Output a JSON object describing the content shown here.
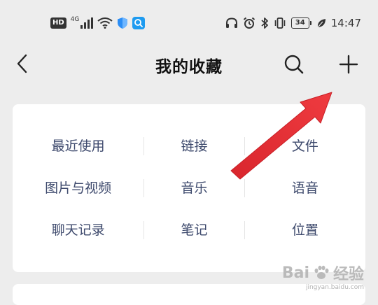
{
  "status_bar": {
    "hd_badge": "HD",
    "network": "4G",
    "battery": "34",
    "time": "14:47"
  },
  "nav": {
    "title": "我的收藏",
    "back_icon": "chevron-left-icon",
    "search_icon": "search-icon",
    "add_icon": "plus-icon"
  },
  "categories": [
    [
      "最近使用",
      "链接",
      "文件"
    ],
    [
      "图片与视频",
      "音乐",
      "语音"
    ],
    [
      "聊天记录",
      "笔记",
      "位置"
    ]
  ],
  "colors": {
    "background": "#ededed",
    "card": "#ffffff",
    "category_text": "#3e4a6d",
    "annotation_arrow": "#e8333a"
  },
  "watermark": {
    "brand": "Bai",
    "brand_suffix": "经验",
    "url": "jingyan.baidu.com"
  }
}
